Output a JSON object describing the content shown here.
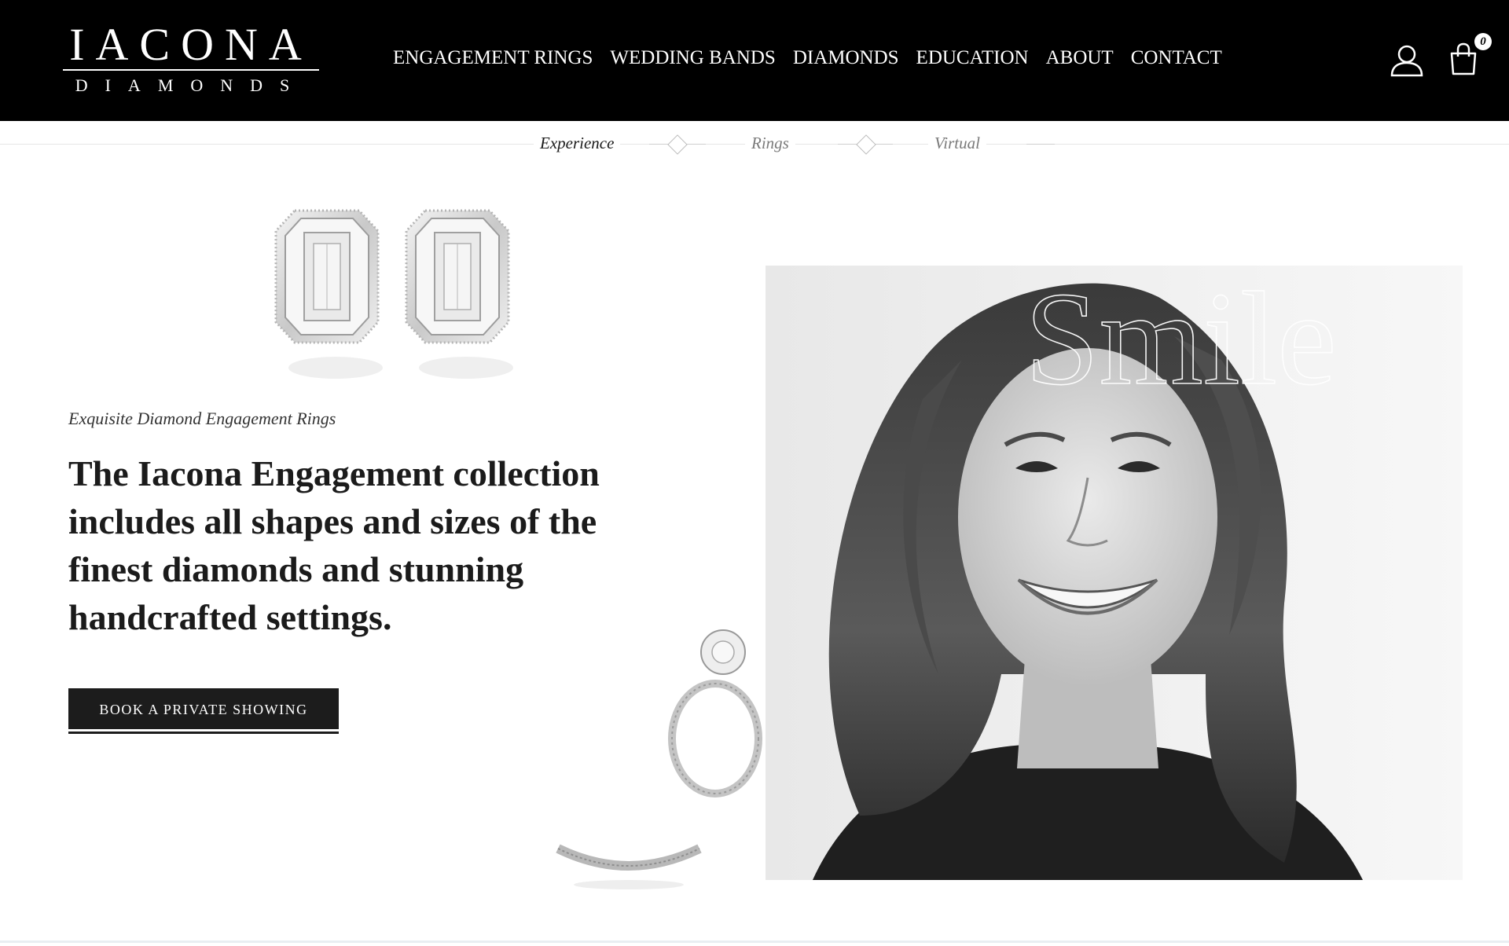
{
  "header": {
    "logo_main": "IACONA",
    "logo_sub": "DIAMONDS",
    "nav": [
      "ENGAGEMENT RINGS",
      "WEDDING BANDS",
      "DIAMONDS",
      "EDUCATION",
      "ABOUT",
      "CONTACT"
    ],
    "cart_count": "0"
  },
  "steps": [
    "Experience",
    "Rings",
    "Virtual"
  ],
  "hero": {
    "kicker": "Exquisite Diamond Engagement Rings",
    "headline": "The Iacona Engagement collection includes all shapes and sizes of the finest diamonds and stunning handcrafted settings.",
    "cta": "BOOK A PRIVATE SHOWING",
    "portrait_overlay": "Smile"
  },
  "icons": {
    "user": "user-icon",
    "cart": "shopping-bag-icon",
    "step_marker": "diamond-icon"
  },
  "colors": {
    "header_bg": "#000000",
    "cta_bg": "#1c1c1c",
    "text": "#1b1b1b"
  }
}
